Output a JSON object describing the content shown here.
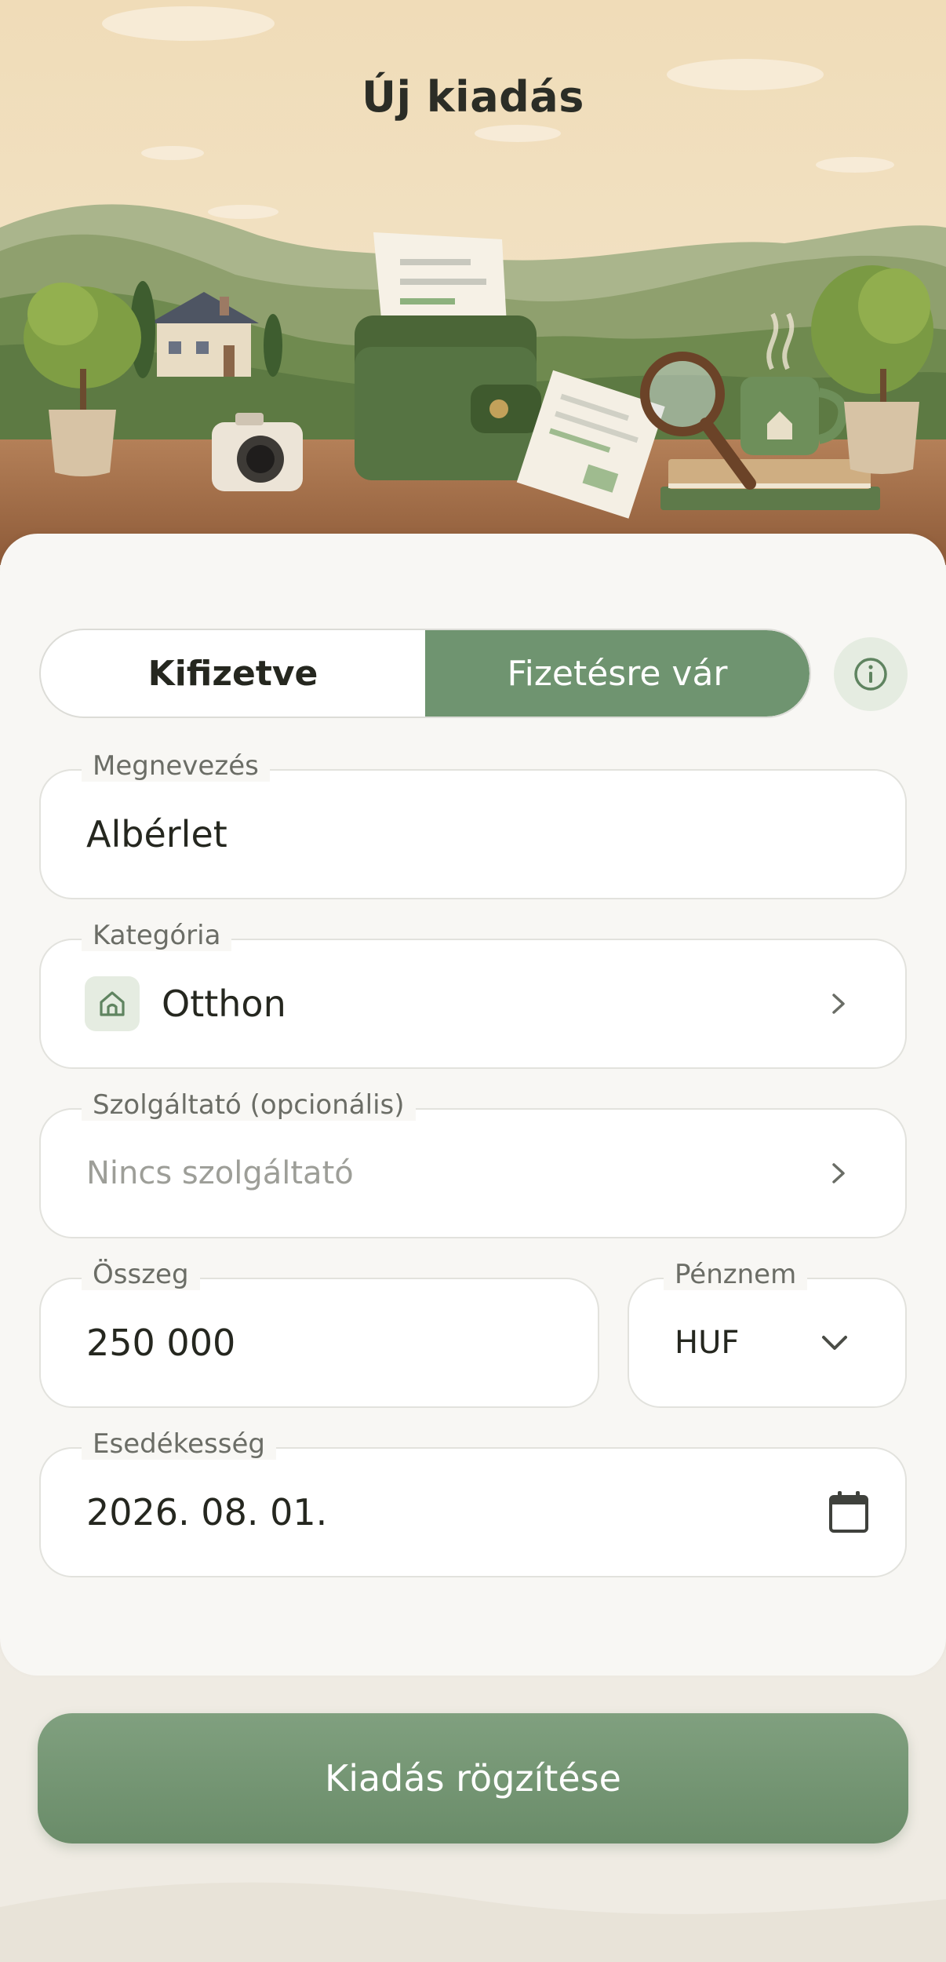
{
  "header": {
    "title": "Új kiadás"
  },
  "status_toggle": {
    "options": [
      "Kifizetve",
      "Fizetésre vár"
    ],
    "selected": "Fizetésre vár"
  },
  "icons": {
    "info": "info-icon",
    "category": "home-icon",
    "chevron": "chevron-right-icon",
    "dropdown": "chevron-down-icon",
    "calendar": "calendar-icon"
  },
  "form": {
    "name": {
      "label": "Megnevezés",
      "value": "Albérlet"
    },
    "category": {
      "label": "Kategória",
      "value": "Otthon"
    },
    "provider": {
      "label": "Szolgáltató (opcionális)",
      "placeholder": "Nincs szolgáltató"
    },
    "amount": {
      "label": "Összeg",
      "value": "250 000"
    },
    "currency": {
      "label": "Pénznem",
      "value": "HUF"
    },
    "due_date": {
      "label": "Esedékesség",
      "value": "2026. 08. 01."
    }
  },
  "submit": {
    "label": "Kiadás rögzítése"
  },
  "colors": {
    "accent": "#6f9470",
    "accent_light": "#e5ece1",
    "card": "#f8f7f4",
    "background": "#efebe3"
  }
}
